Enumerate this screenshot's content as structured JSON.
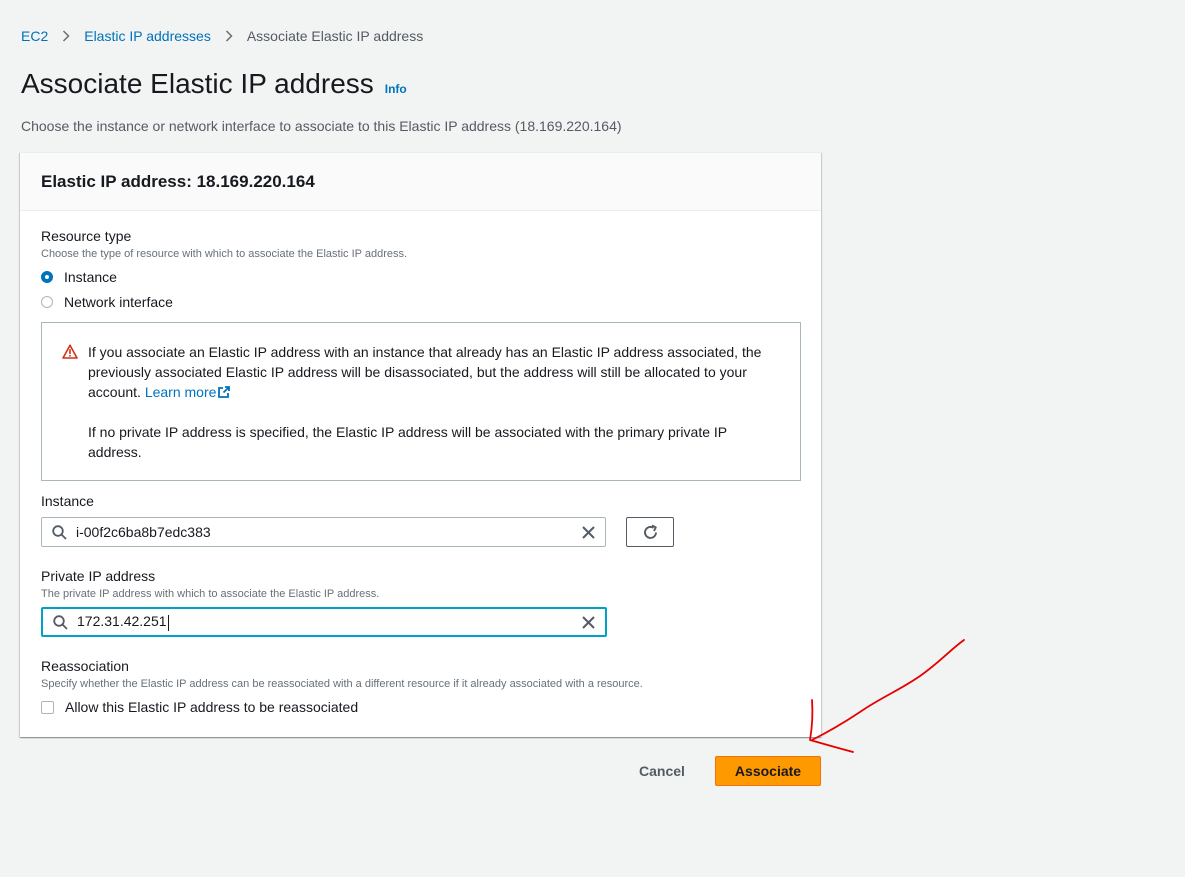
{
  "breadcrumb": {
    "items": [
      {
        "label": "EC2"
      },
      {
        "label": "Elastic IP addresses"
      },
      {
        "label": "Associate Elastic IP address"
      }
    ]
  },
  "page": {
    "title": "Associate Elastic IP address",
    "info": "Info",
    "subtitle": "Choose the instance or network interface to associate to this Elastic IP address (18.169.220.164)"
  },
  "panel": {
    "header": "Elastic IP address: 18.169.220.164",
    "resource_type": {
      "label": "Resource type",
      "description": "Choose the type of resource with which to associate the Elastic IP address.",
      "options": [
        {
          "label": "Instance",
          "selected": true
        },
        {
          "label": "Network interface",
          "selected": false
        }
      ]
    },
    "alert": {
      "text1": "If you associate an Elastic IP address with an instance that already has an Elastic IP address associated, the previously associated Elastic IP address will be disassociated, but the address will still be allocated to your account.",
      "learn_more": "Learn more",
      "text2": "If no private IP address is specified, the Elastic IP address will be associated with the primary private IP address."
    },
    "instance": {
      "label": "Instance",
      "value": "i-00f2c6ba8b7edc383"
    },
    "private_ip": {
      "label": "Private IP address",
      "description": "The private IP address with which to associate the Elastic IP address.",
      "value": "172.31.42.251"
    },
    "reassociation": {
      "label": "Reassociation",
      "description": "Specify whether the Elastic IP address can be reassociated with a different resource if it already associated with a resource.",
      "checkbox_label": "Allow this Elastic IP address to be reassociated",
      "checked": false
    }
  },
  "actions": {
    "cancel": "Cancel",
    "associate": "Associate"
  },
  "colors": {
    "link": "#0073bb",
    "primary_button": "#ff9900",
    "focus": "#00a1c9",
    "warning": "#d13212",
    "annotation": "#e60000"
  }
}
